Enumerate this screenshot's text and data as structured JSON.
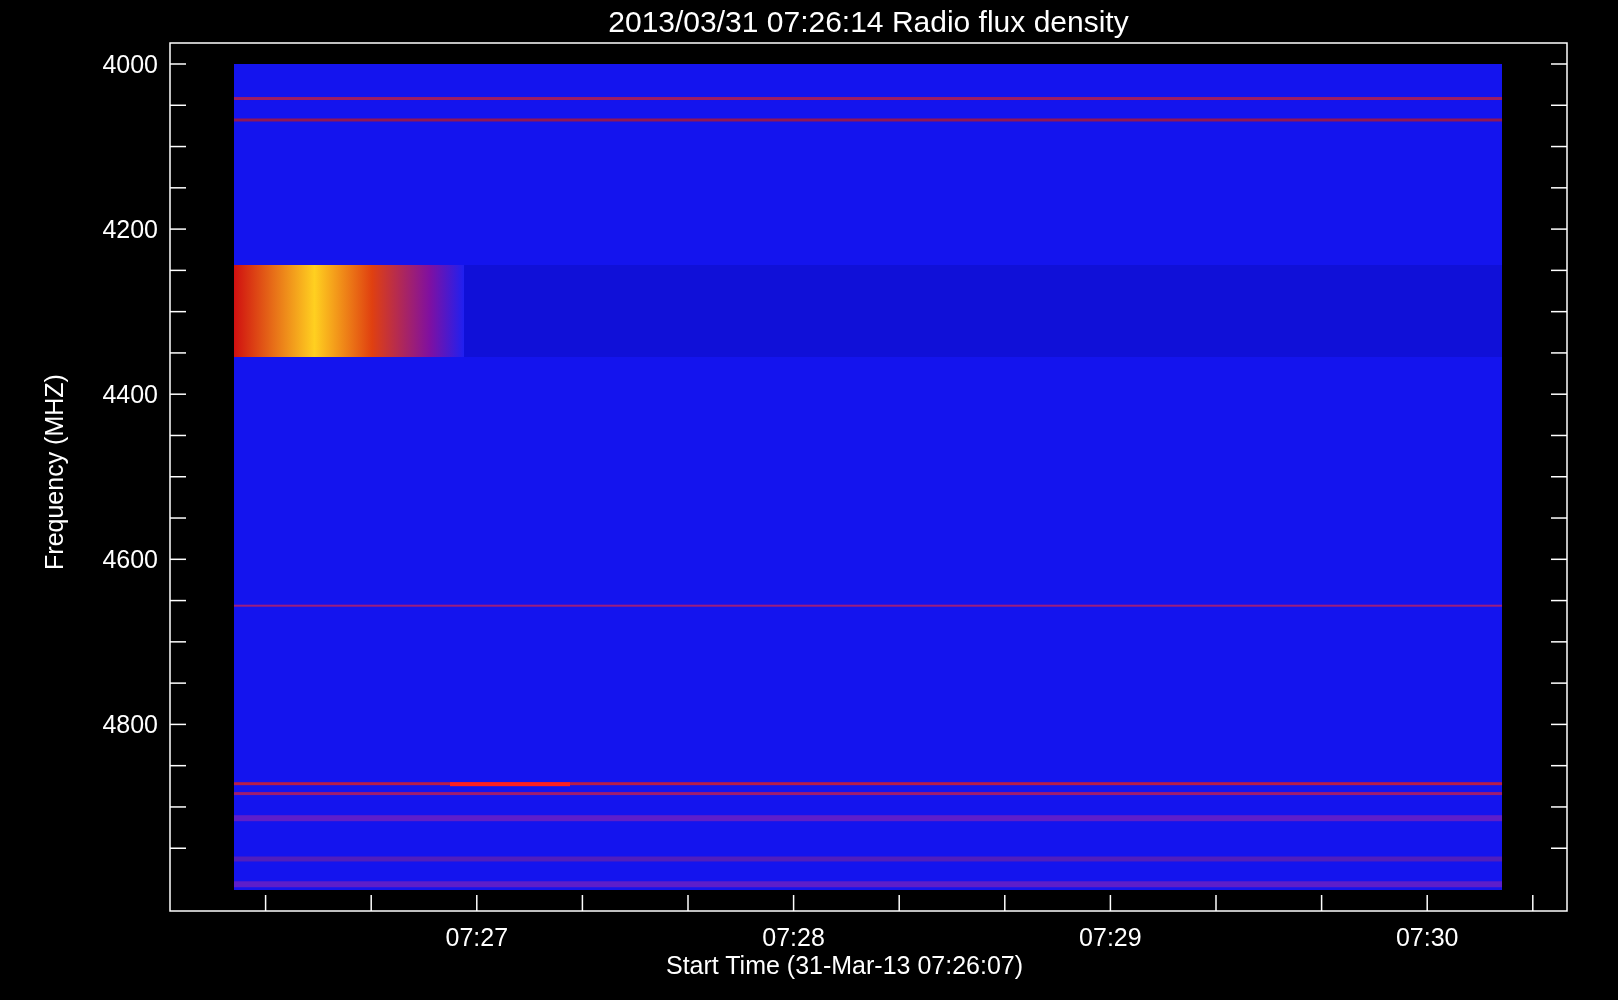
{
  "title": "2013/03/31 07:26:14 Radio flux density",
  "y_axis": {
    "label": "Frequency (MHZ)",
    "ticks": [
      "4000",
      "4200",
      "4400",
      "4600",
      "4800"
    ]
  },
  "x_axis": {
    "label": "Start Time (31-Mar-13 07:26:07)",
    "ticks": [
      "07:27",
      "07:28",
      "07:29",
      "07:30"
    ]
  }
}
